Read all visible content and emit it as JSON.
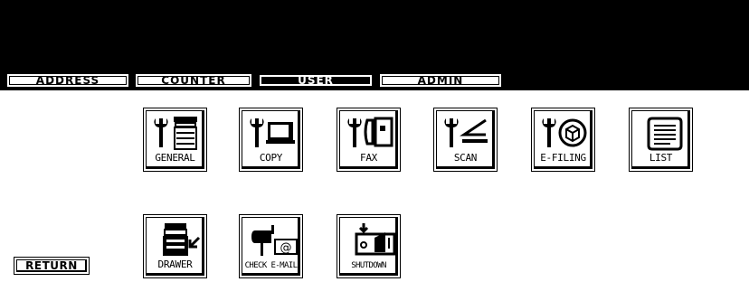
{
  "tabs": [
    {
      "label": "ADDRESS",
      "active": false
    },
    {
      "label": "COUNTER",
      "active": false
    },
    {
      "label": "USER",
      "active": true
    },
    {
      "label": "ADMIN",
      "active": false
    }
  ],
  "menu": {
    "row1": [
      {
        "label": "GENERAL",
        "icon": "wrench-copier-icon"
      },
      {
        "label": "COPY",
        "icon": "wrench-copy-icon"
      },
      {
        "label": "FAX",
        "icon": "wrench-fax-icon"
      },
      {
        "label": "SCAN",
        "icon": "wrench-scan-icon"
      },
      {
        "label": "E-FILING",
        "icon": "wrench-box-icon"
      },
      {
        "label": "LIST",
        "icon": "list-scroll-icon"
      }
    ],
    "row2": [
      {
        "label": "DRAWER",
        "icon": "drawer-copier-icon"
      },
      {
        "label": "CHECK E-MAIL",
        "icon": "mailbox-icon"
      },
      {
        "label": "SHUTDOWN",
        "icon": "power-switch-icon"
      }
    ]
  },
  "return_label": "RETURN"
}
